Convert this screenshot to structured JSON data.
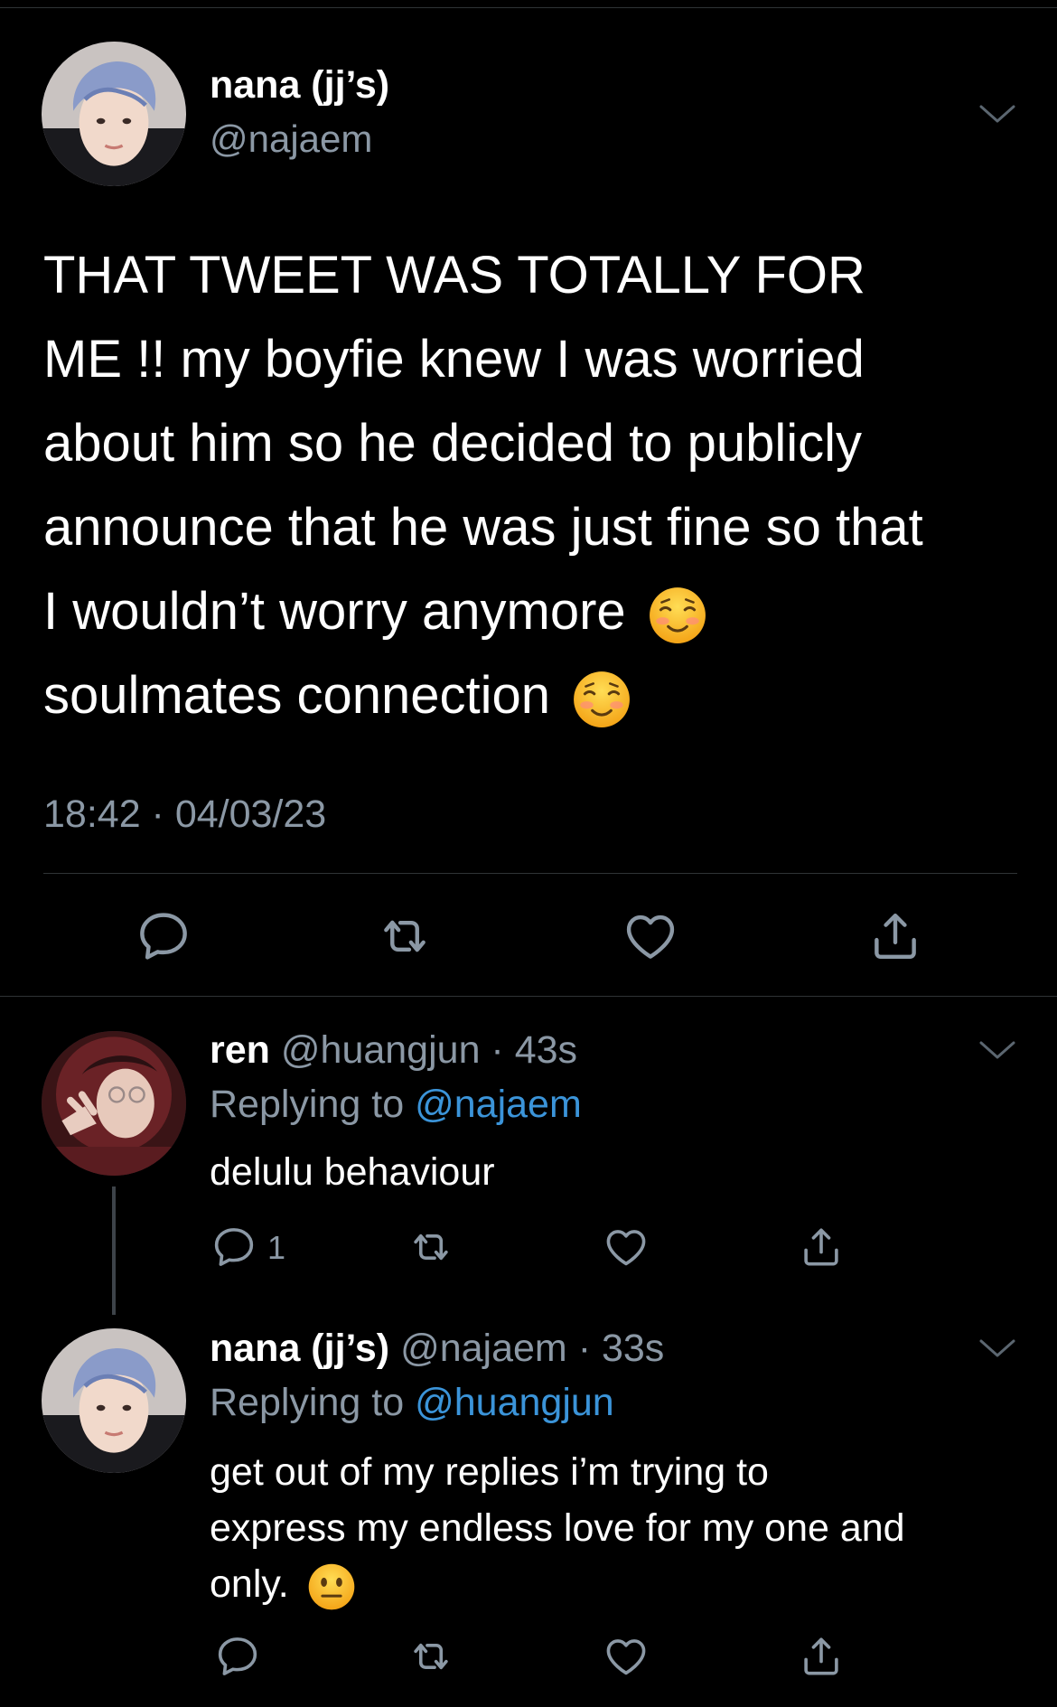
{
  "main_tweet": {
    "display_name": "nana (jj’s)",
    "handle": "@najaem",
    "text_lines": [
      "THAT TWEET WAS TOTALLY FOR",
      "ME !! my boyfie knew I was worried",
      "about him so he decided to publicly",
      "announce that he was just fine so that",
      "I wouldn’t worry anymore",
      "soulmates connection"
    ],
    "timestamp": "18:42 · 04/03/23"
  },
  "reply_1": {
    "display_name": "ren",
    "handle_time": "@huangjun · 43s",
    "replying_prefix": "Replying to",
    "replying_mention": "@najaem",
    "text_lines": [
      "delulu behaviour"
    ],
    "reply_count": "1"
  },
  "reply_2": {
    "display_name": "nana (jj’s)",
    "handle_time": "@najaem · 33s",
    "replying_prefix": "Replying to",
    "replying_mention": "@huangjun",
    "text_lines": [
      "get out of my replies i’m trying to",
      "express my endless love for my one and",
      "only."
    ]
  },
  "icons": {
    "reply": "speech-bubble-icon",
    "retweet": "retweet-icon",
    "like": "heart-icon",
    "share": "share-icon",
    "more": "chevron-down-icon",
    "smile_emoji": "smiling-face-emoji",
    "neutral_emoji": "neutral-face-emoji"
  },
  "colors": {
    "background": "#000000",
    "text": "#ffffff",
    "secondary": "#8b98a5",
    "link": "#3b94d9",
    "divider": "#2f3336"
  }
}
